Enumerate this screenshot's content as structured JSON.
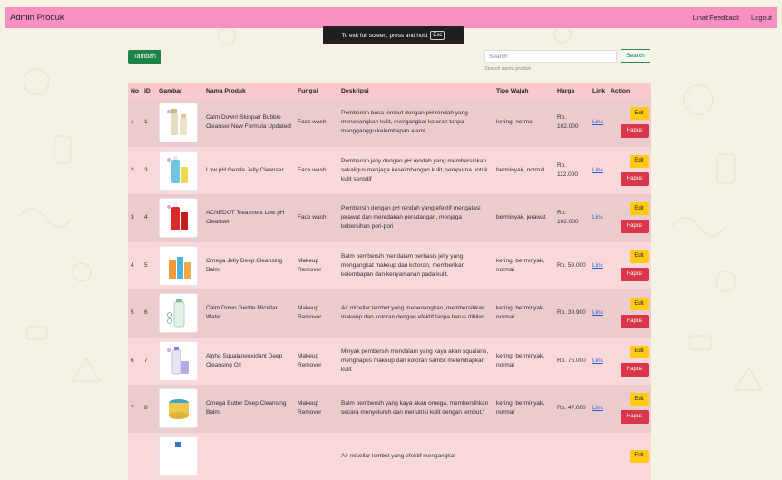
{
  "navbar": {
    "brand": "Admin Produk",
    "feedback_link": "Lihat Feedback",
    "logout_link": "Logout"
  },
  "fullscreen_notice": {
    "text": "To exit full screen, press and hold",
    "key": "Esc"
  },
  "toolbar": {
    "add_label": "Tambah",
    "search_placeholder": "Search",
    "search_hint": "Search nama produk",
    "search_label": "Search"
  },
  "table": {
    "headers": [
      "No",
      "ID",
      "Gambar",
      "Nama Produk",
      "Fungsi",
      "Deskripsi",
      "Tipe Wajah",
      "Harga",
      "Link",
      "Action"
    ],
    "edit_label": "Edit",
    "delete_label": "Hapus",
    "rows": [
      {
        "no": "1",
        "id": "1",
        "nama": "Calm Down! Skinpair Bubble Cleanser New Formula Updated!",
        "fungsi": "Face wash",
        "deskripsi": "Pembersih busa lembut dengan pH rendah yang menenangkan kulit, mengangkat kotoran tanpa mengganggu kelembapan alami.",
        "tipe": "kering, normal",
        "harga": "Rp. 102.000",
        "link": "Link"
      },
      {
        "no": "2",
        "id": "3",
        "nama": "Low pH Gentle Jelly Cleanser",
        "fungsi": "Face wash",
        "deskripsi": "Pembersih jelly dengan pH rendah yang membersihkan sekaligus menjaga keseimbangan kulit, sempurna untuk kulit sensitif",
        "tipe": "berminyak, normal",
        "harga": "Rp. 112.000",
        "link": "Link"
      },
      {
        "no": "3",
        "id": "4",
        "nama": "ACNEDOT Treatment Low pH Cleanser",
        "fungsi": "Face wash",
        "deskripsi": "Pembersih dengan pH rendah yang efektif mengatasi jerawat dan meredakan peradangan, menjaga kebersihan pori-pori",
        "tipe": "berminyak, jerawat",
        "harga": "Rp. 102.000",
        "link": "Link"
      },
      {
        "no": "4",
        "id": "5",
        "nama": "Omega Jelly Deep Cleansing Balm",
        "fungsi": "Makeup Remover",
        "deskripsi": "Balm pembersih mendalam berbasis jelly yang mengangkat makeup dan kotoran, memberikan kelembapan dan kenyamanan pada kulit.",
        "tipe": "kering, berminyak, normal",
        "harga": "Rp. 59.000",
        "link": "Link"
      },
      {
        "no": "5",
        "id": "6",
        "nama": "Calm Down Gentle Micellar Water",
        "fungsi": "Makeup Remover",
        "deskripsi": "Air micellar lembut yang menenangkan, membersihkan makeup dan kotoran dengan efektif tanpa harus dibilas.",
        "tipe": "kering, berminyak, normal",
        "harga": "Rp. 39.900",
        "link": "Link"
      },
      {
        "no": "6",
        "id": "7",
        "nama": "Alpha Squalaneoxidant Deep Cleansing Oil",
        "fungsi": "Makeup Remover",
        "deskripsi": "Minyak pembersih mendalam yang kaya akan squalane, menghapus makeup dan kotoran sambil melembapkan kulit",
        "tipe": "kering, berminyak, normal",
        "harga": "Rp. 75.000",
        "link": "Link"
      },
      {
        "no": "7",
        "id": "8",
        "nama": "Omega Butter Deep Cleansing Balm",
        "fungsi": "Makeup Remover",
        "deskripsi": "Balm pembersih yang kaya akan omega, membersihkan secara menyeluruh dan menutrisi kulit dengan lembut.\"",
        "tipe": "kering, berminyak, normal",
        "harga": "Rp. 47.000",
        "link": "Link"
      },
      {
        "no": "",
        "id": "",
        "nama": "",
        "fungsi": "",
        "deskripsi": "Air micellar lembut yang efektif mengangkat",
        "tipe": "",
        "harga": "",
        "link": ""
      }
    ]
  }
}
